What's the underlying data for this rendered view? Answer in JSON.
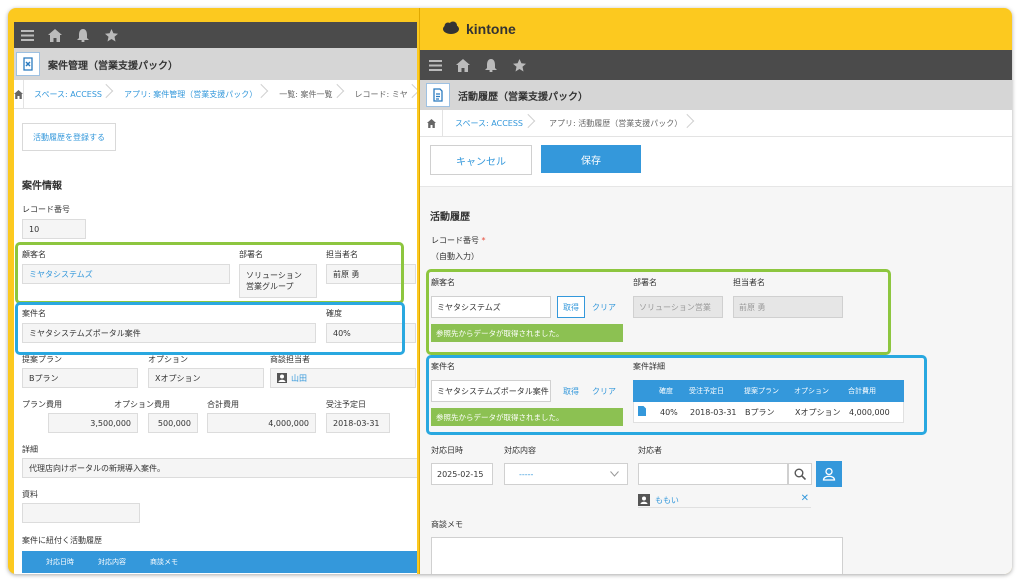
{
  "left": {
    "app_title": "案件管理（営業支援パック）",
    "breadcrumb": [
      "スペース: ACCESS",
      "アプリ: 案件管理（営業支援パック）",
      "一覧: 案件一覧",
      "レコード: ミヤ"
    ],
    "register_button": "活動履歴を登録する",
    "section_title": "案件情報",
    "record_no_label": "レコード番号",
    "record_no": "10",
    "customer_label": "顧客名",
    "customer": "ミヤタシステムズ",
    "dept_label": "部署名",
    "dept_line1": "ソリューション",
    "dept_line2": "営業グループ",
    "person_label": "担当者名",
    "person": "前原 勇",
    "case_label": "案件名",
    "case": "ミヤタシステムズポータル案件",
    "certainty_label": "確度",
    "certainty": "40%",
    "plan_label": "提案プラン",
    "plan": "Bプラン",
    "option_label": "オプション",
    "option": "Xオプション",
    "sales_label": "商談担当者",
    "sales": "山田",
    "plan_cost_label": "プラン費用",
    "plan_cost": "3,500,000",
    "option_cost_label": "オプション費用",
    "option_cost": "500,000",
    "total_label": "合計費用",
    "total": "4,000,000",
    "date_label": "受注予定日",
    "date": "2018-03-31",
    "detail_label": "詳細",
    "detail": "代理店向けポータルの新規導入案件。",
    "material_label": "資料",
    "related_label": "案件に紐付く活動履歴",
    "related_headers": [
      "対応日時",
      "対応内容",
      "商談メモ"
    ]
  },
  "right": {
    "brand": "kintone",
    "app_title": "活動履歴（営業支援パック）",
    "breadcrumb": [
      "スペース: ACCESS",
      "アプリ: 活動履歴（営業支援パック）"
    ],
    "cancel": "キャンセル",
    "save": "保存",
    "section_title": "活動履歴",
    "record_no_label": "レコード番号",
    "required_mark": "*",
    "auto_input": "（自動入力）",
    "customer_label": "顧客名",
    "customer": "ミヤタシステムズ",
    "get_button": "取得",
    "clear_button": "クリア",
    "dept_label": "部署名",
    "dept": "ソリューション営業",
    "person_label": "担当者名",
    "person": "前原 勇",
    "notice": "参照先からデータが取得されました。",
    "case_label": "案件名",
    "case": "ミヤタシステムズポータル案件",
    "case_detail_label": "案件詳細",
    "subtable_headers": [
      "確度",
      "受注予定日",
      "提案プラン",
      "オプション",
      "合計費用"
    ],
    "subtable_row": [
      "40%",
      "2018-03-31",
      "Bプラン",
      "Xオプション",
      "4,000,000"
    ],
    "date_label": "対応日時",
    "date": "2025-02-15",
    "content_label": "対応内容",
    "content": "-----",
    "responder_label": "対応者",
    "responder": "ももい",
    "memo_label": "商談メモ"
  },
  "colors": {
    "frame": "#fcc91f",
    "topbar": "#4b4b4b",
    "accent": "#3498db",
    "green": "#8dc63f",
    "blue": "#29a8e0"
  }
}
